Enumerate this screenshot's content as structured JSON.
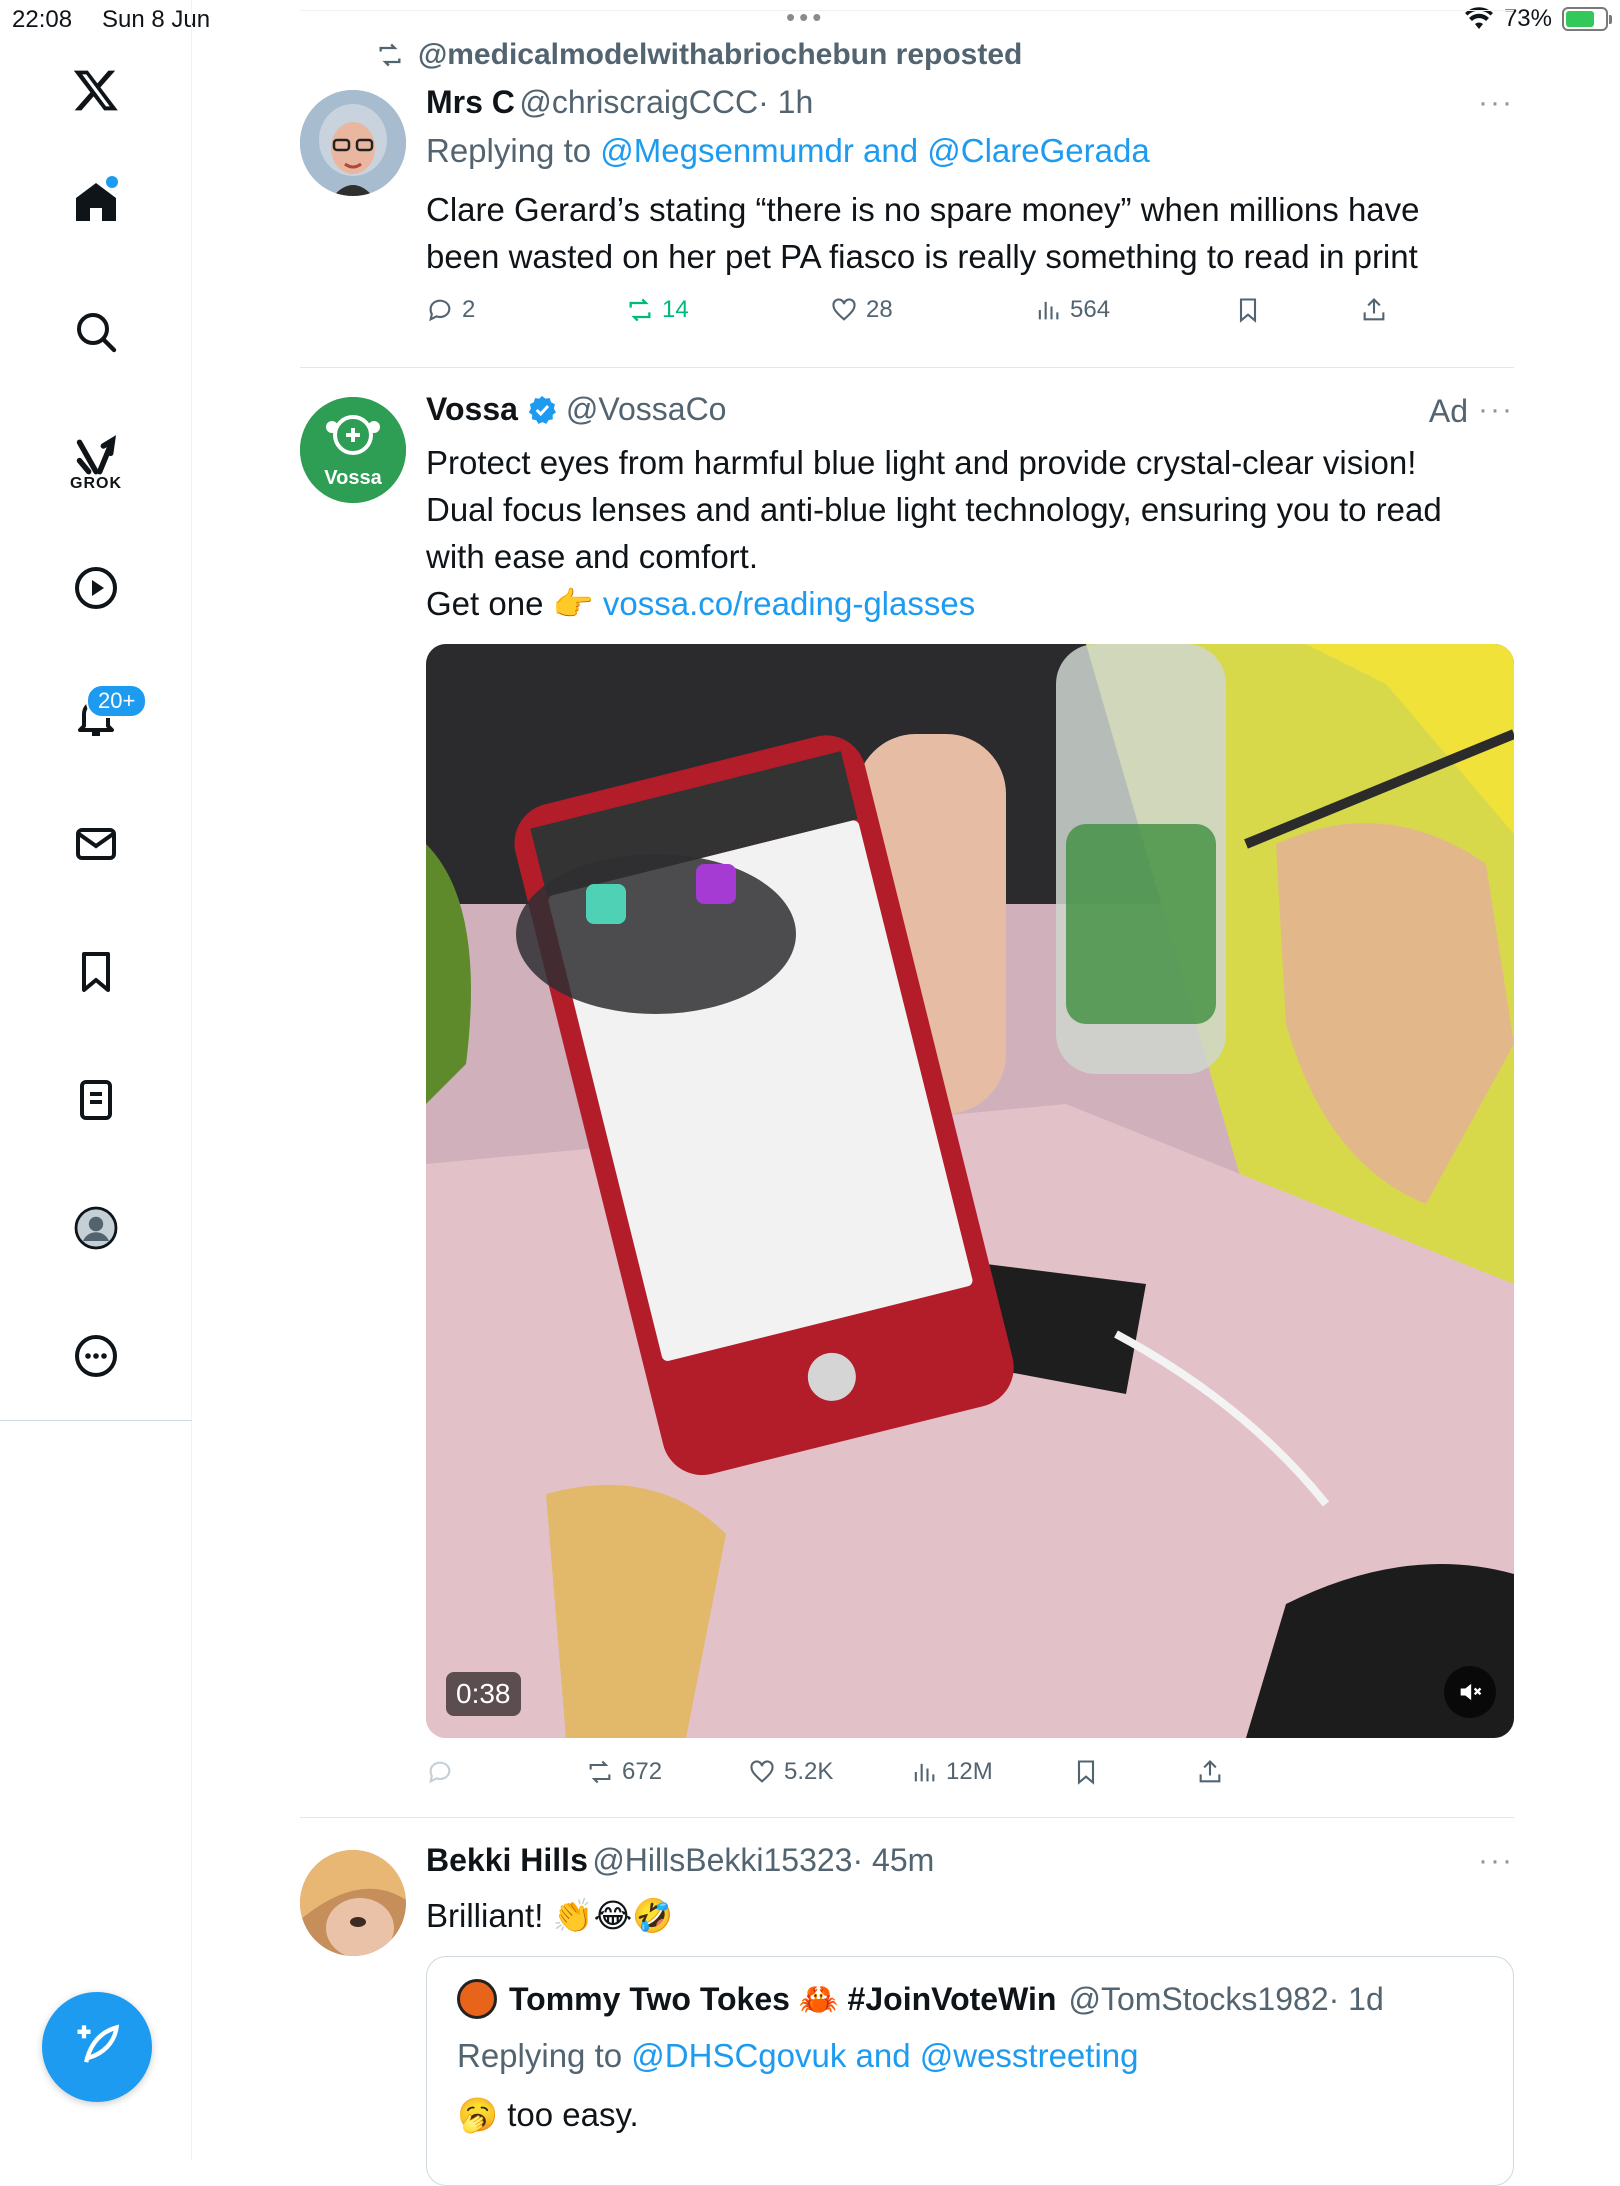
{
  "status_bar": {
    "time": "22:08",
    "date": "Sun 8 Jun",
    "battery": "73%",
    "battery_level": 0.73
  },
  "sidebar": {
    "grok_label": "GROK",
    "notification_badge": "20+",
    "icons": [
      "x-logo-icon",
      "home-icon",
      "search-icon",
      "grok-icon",
      "video-icon",
      "bell-icon",
      "mail-icon",
      "bookmark-icon",
      "list-icon",
      "profile-icon",
      "more-icon"
    ]
  },
  "compose": {
    "icon": "compose-icon"
  },
  "tweets": [
    {
      "repost_line": "@medicalmodelwithabriochebun reposted",
      "name": "Mrs C",
      "handle": "@chriscraigCCC",
      "time": "· 1h",
      "reply_prefix": "Replying to",
      "reply_to": "@Megsenmumdr and @ClareGerada",
      "text": "Clare Gerard’s stating “there is no spare money” when millions have been wasted on her pet PA fiasco is really something to read in print",
      "replies": "2",
      "reposts": "14",
      "likes": "28",
      "views": "564"
    },
    {
      "name": "Vossa",
      "handle": "@VossaCo",
      "ad_label": "Ad",
      "avatar_text": "Vossa",
      "text_line1": "Protect eyes from harmful blue light and provide crystal-clear vision! Dual focus lenses and anti-blue light technology, ensuring you to read with ease and comfort.",
      "text_line2_prefix": "Get one 👉",
      "link": "vossa.co/reading-glasses",
      "video_duration": "0:38",
      "reposts": "672",
      "likes": "5.2K",
      "views": "12M"
    },
    {
      "name": "Bekki Hills",
      "handle": "@HillsBekki15323",
      "time": "· 45m",
      "text": "Brilliant! 👏😂🤣",
      "quote": {
        "name": "Tommy Two Tokes 🦀 #JoinVoteWin",
        "handle": "@TomStocks1982",
        "time": "· 1d",
        "reply_prefix": "Replying to",
        "reply_to": "@DHSCgovuk and @wesstreeting",
        "text": "🥱 too easy."
      }
    }
  ],
  "colors": {
    "accent": "#1d9bf0",
    "repost_green": "#00ba7c",
    "muted": "#536471"
  }
}
